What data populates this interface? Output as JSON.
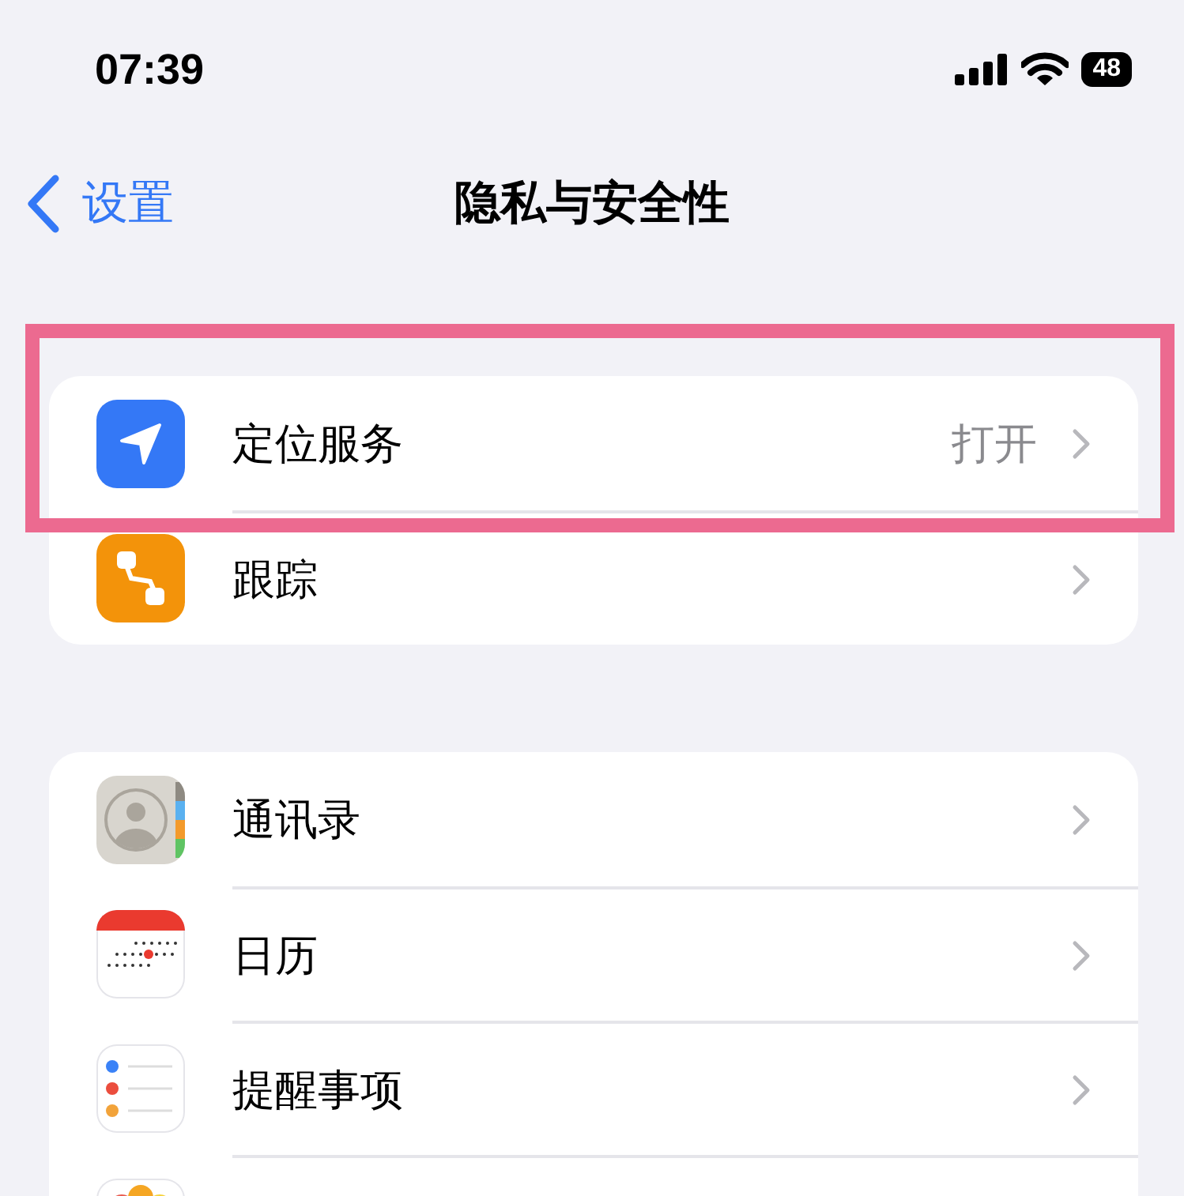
{
  "status_bar": {
    "time": "07:39",
    "battery": "48"
  },
  "nav": {
    "back": "设置",
    "title": "隐私与安全性"
  },
  "groups": [
    {
      "rows": [
        {
          "kind": "location",
          "label": "定位服务",
          "value": "打开",
          "highlighted": true
        },
        {
          "kind": "tracking",
          "label": "跟踪",
          "highlighted": false
        }
      ]
    },
    {
      "rows": [
        {
          "kind": "contacts",
          "label": "通讯录",
          "highlighted": false
        },
        {
          "kind": "calendar",
          "label": "日历",
          "highlighted": false
        },
        {
          "kind": "reminders",
          "label": "提醒事项",
          "highlighted": false
        },
        {
          "kind": "photos",
          "highlighted": false
        }
      ]
    }
  ]
}
